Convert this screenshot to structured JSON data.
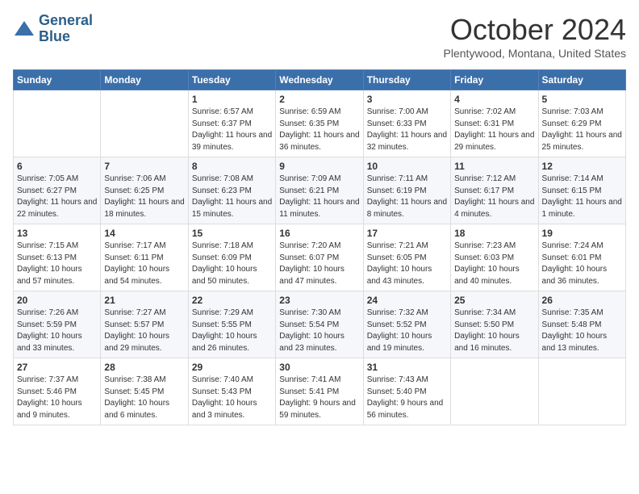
{
  "header": {
    "logo_line1": "General",
    "logo_line2": "Blue",
    "month": "October 2024",
    "location": "Plentywood, Montana, United States"
  },
  "days_of_week": [
    "Sunday",
    "Monday",
    "Tuesday",
    "Wednesday",
    "Thursday",
    "Friday",
    "Saturday"
  ],
  "weeks": [
    [
      {
        "day": "",
        "info": ""
      },
      {
        "day": "",
        "info": ""
      },
      {
        "day": "1",
        "info": "Sunrise: 6:57 AM\nSunset: 6:37 PM\nDaylight: 11 hours and 39 minutes."
      },
      {
        "day": "2",
        "info": "Sunrise: 6:59 AM\nSunset: 6:35 PM\nDaylight: 11 hours and 36 minutes."
      },
      {
        "day": "3",
        "info": "Sunrise: 7:00 AM\nSunset: 6:33 PM\nDaylight: 11 hours and 32 minutes."
      },
      {
        "day": "4",
        "info": "Sunrise: 7:02 AM\nSunset: 6:31 PM\nDaylight: 11 hours and 29 minutes."
      },
      {
        "day": "5",
        "info": "Sunrise: 7:03 AM\nSunset: 6:29 PM\nDaylight: 11 hours and 25 minutes."
      }
    ],
    [
      {
        "day": "6",
        "info": "Sunrise: 7:05 AM\nSunset: 6:27 PM\nDaylight: 11 hours and 22 minutes."
      },
      {
        "day": "7",
        "info": "Sunrise: 7:06 AM\nSunset: 6:25 PM\nDaylight: 11 hours and 18 minutes."
      },
      {
        "day": "8",
        "info": "Sunrise: 7:08 AM\nSunset: 6:23 PM\nDaylight: 11 hours and 15 minutes."
      },
      {
        "day": "9",
        "info": "Sunrise: 7:09 AM\nSunset: 6:21 PM\nDaylight: 11 hours and 11 minutes."
      },
      {
        "day": "10",
        "info": "Sunrise: 7:11 AM\nSunset: 6:19 PM\nDaylight: 11 hours and 8 minutes."
      },
      {
        "day": "11",
        "info": "Sunrise: 7:12 AM\nSunset: 6:17 PM\nDaylight: 11 hours and 4 minutes."
      },
      {
        "day": "12",
        "info": "Sunrise: 7:14 AM\nSunset: 6:15 PM\nDaylight: 11 hours and 1 minute."
      }
    ],
    [
      {
        "day": "13",
        "info": "Sunrise: 7:15 AM\nSunset: 6:13 PM\nDaylight: 10 hours and 57 minutes."
      },
      {
        "day": "14",
        "info": "Sunrise: 7:17 AM\nSunset: 6:11 PM\nDaylight: 10 hours and 54 minutes."
      },
      {
        "day": "15",
        "info": "Sunrise: 7:18 AM\nSunset: 6:09 PM\nDaylight: 10 hours and 50 minutes."
      },
      {
        "day": "16",
        "info": "Sunrise: 7:20 AM\nSunset: 6:07 PM\nDaylight: 10 hours and 47 minutes."
      },
      {
        "day": "17",
        "info": "Sunrise: 7:21 AM\nSunset: 6:05 PM\nDaylight: 10 hours and 43 minutes."
      },
      {
        "day": "18",
        "info": "Sunrise: 7:23 AM\nSunset: 6:03 PM\nDaylight: 10 hours and 40 minutes."
      },
      {
        "day": "19",
        "info": "Sunrise: 7:24 AM\nSunset: 6:01 PM\nDaylight: 10 hours and 36 minutes."
      }
    ],
    [
      {
        "day": "20",
        "info": "Sunrise: 7:26 AM\nSunset: 5:59 PM\nDaylight: 10 hours and 33 minutes."
      },
      {
        "day": "21",
        "info": "Sunrise: 7:27 AM\nSunset: 5:57 PM\nDaylight: 10 hours and 29 minutes."
      },
      {
        "day": "22",
        "info": "Sunrise: 7:29 AM\nSunset: 5:55 PM\nDaylight: 10 hours and 26 minutes."
      },
      {
        "day": "23",
        "info": "Sunrise: 7:30 AM\nSunset: 5:54 PM\nDaylight: 10 hours and 23 minutes."
      },
      {
        "day": "24",
        "info": "Sunrise: 7:32 AM\nSunset: 5:52 PM\nDaylight: 10 hours and 19 minutes."
      },
      {
        "day": "25",
        "info": "Sunrise: 7:34 AM\nSunset: 5:50 PM\nDaylight: 10 hours and 16 minutes."
      },
      {
        "day": "26",
        "info": "Sunrise: 7:35 AM\nSunset: 5:48 PM\nDaylight: 10 hours and 13 minutes."
      }
    ],
    [
      {
        "day": "27",
        "info": "Sunrise: 7:37 AM\nSunset: 5:46 PM\nDaylight: 10 hours and 9 minutes."
      },
      {
        "day": "28",
        "info": "Sunrise: 7:38 AM\nSunset: 5:45 PM\nDaylight: 10 hours and 6 minutes."
      },
      {
        "day": "29",
        "info": "Sunrise: 7:40 AM\nSunset: 5:43 PM\nDaylight: 10 hours and 3 minutes."
      },
      {
        "day": "30",
        "info": "Sunrise: 7:41 AM\nSunset: 5:41 PM\nDaylight: 9 hours and 59 minutes."
      },
      {
        "day": "31",
        "info": "Sunrise: 7:43 AM\nSunset: 5:40 PM\nDaylight: 9 hours and 56 minutes."
      },
      {
        "day": "",
        "info": ""
      },
      {
        "day": "",
        "info": ""
      }
    ]
  ]
}
